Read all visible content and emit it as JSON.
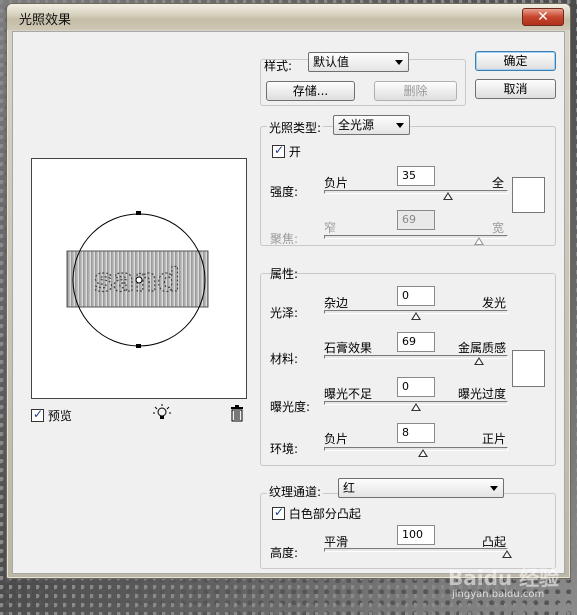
{
  "window": {
    "title": "光照效果",
    "close_glyph": "✕"
  },
  "style": {
    "label": "样式:",
    "value": "默认值",
    "store_label": "存储...",
    "delete_label": "删除"
  },
  "buttons": {
    "ok": "确定",
    "cancel": "取消"
  },
  "light_type": {
    "label": "光照类型:",
    "value": "全光源",
    "on_label": "开",
    "intensity": {
      "label": "强度:",
      "min_label": "负片",
      "max_label": "全",
      "value": "35"
    },
    "focus": {
      "label": "聚焦:",
      "min_label": "窄",
      "max_label": "宽",
      "value": "69"
    }
  },
  "properties": {
    "label": "属性:",
    "gloss": {
      "label": "光泽:",
      "min_label": "杂边",
      "max_label": "发光",
      "value": "0"
    },
    "material": {
      "label": "材料:",
      "min_label": "石膏效果",
      "max_label": "金属质感",
      "value": "69"
    },
    "exposure": {
      "label": "曝光度:",
      "min_label": "曝光不足",
      "max_label": "曝光过度",
      "value": "0"
    },
    "ambience": {
      "label": "环境:",
      "min_label": "负片",
      "max_label": "正片",
      "value": "8"
    }
  },
  "texture": {
    "label": "纹理通道:",
    "value": "红",
    "white_high_label": "白色部分凸起",
    "height": {
      "label": "高度:",
      "min_label": "平滑",
      "max_label": "凸起",
      "value": "100"
    }
  },
  "preview": {
    "label": "预览",
    "sample_text": "sand"
  },
  "icons": {
    "bulb": "lightbulb-icon",
    "trash": "trash-icon"
  },
  "watermark": {
    "text": "Baidu 经验",
    "url": "jingyan.baidu.com"
  }
}
